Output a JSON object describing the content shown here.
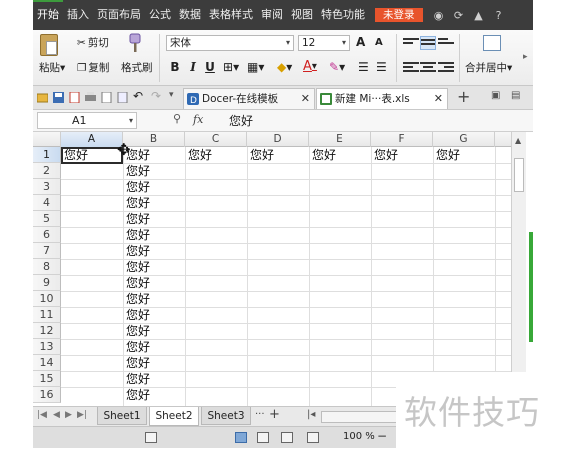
{
  "menubar": {
    "items": [
      "开始",
      "插入",
      "页面布局",
      "公式",
      "数据",
      "表格样式",
      "审阅",
      "视图",
      "特色功能"
    ],
    "login": "未登录"
  },
  "ribbon": {
    "paste": "粘贴",
    "cut": "剪切",
    "copy": "复制",
    "format_painter": "格式刷",
    "font_name": "宋体",
    "font_size": "12",
    "grow_font": "A",
    "shrink_font": "A",
    "bold": "B",
    "italic": "I",
    "underline": "U",
    "font_color": "A",
    "merge_center": "合并居中"
  },
  "docbar": {
    "tabs": [
      {
        "label": "Docer-在线模板"
      },
      {
        "label": "新建 Mi···表.xls"
      }
    ],
    "add": "+"
  },
  "formula": {
    "cell_ref": "A1",
    "fx": "fx",
    "value": "您好"
  },
  "grid": {
    "columns": [
      "A",
      "B",
      "C",
      "D",
      "E",
      "F",
      "G"
    ],
    "rows": [
      "1",
      "2",
      "3",
      "4",
      "5",
      "6",
      "7",
      "8",
      "9",
      "10",
      "11",
      "12",
      "13",
      "14",
      "15",
      "16"
    ],
    "cell_text": "您好",
    "row1_cells": [
      "您好",
      "您好",
      "您好",
      "您好",
      "您好",
      "您好",
      "您好"
    ],
    "colB_cells": [
      "您好",
      "您好",
      "您好",
      "您好",
      "您好",
      "您好",
      "您好",
      "您好",
      "您好",
      "您好",
      "您好",
      "您好",
      "您好",
      "您好",
      "您好"
    ],
    "selected_cell": "A1"
  },
  "sheets": {
    "tabs": [
      "Sheet1",
      "Sheet2",
      "Sheet3"
    ],
    "active": "Sheet2",
    "more": "···",
    "add": "+"
  },
  "status": {
    "zoom": "100 %",
    "zoom_minus": "−"
  },
  "watermark": "软件技巧",
  "colors": {
    "menubar_bg": "#3c3c3c",
    "login_bg": "#e8542c",
    "accent_green": "#38a838"
  }
}
